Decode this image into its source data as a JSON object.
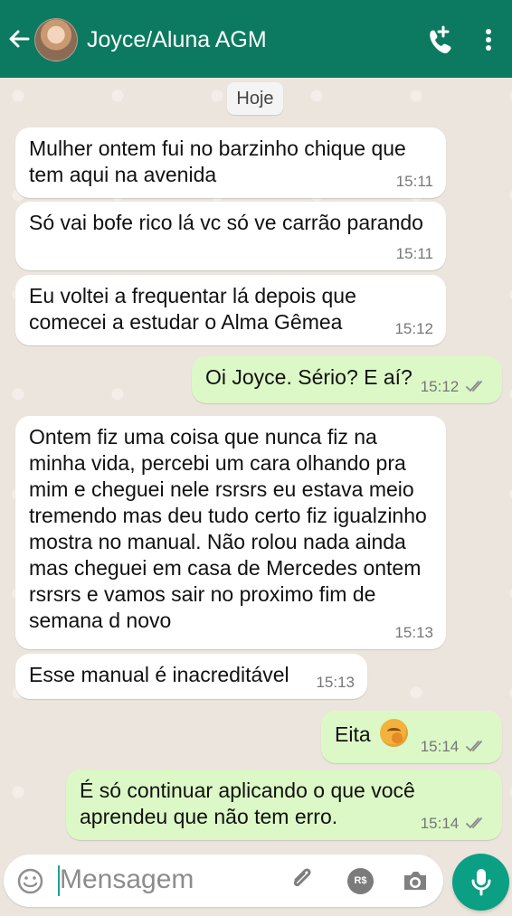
{
  "header": {
    "contact_name": "Joyce/Aluna AGM",
    "back_icon": "arrow-left-icon",
    "avatar": "contact-avatar",
    "call_add_icon": "add-call-icon",
    "menu_icon": "more-vert-icon",
    "colors": {
      "background": "#0b7a61",
      "text": "#ffffff"
    }
  },
  "chat": {
    "date_label": "Hoje",
    "messages": [
      {
        "direction": "in",
        "text": "Mulher ontem fui no barzinho chique que tem aqui na avenida",
        "time": "15:11"
      },
      {
        "direction": "in",
        "text": "Só vai bofe rico lá vc só ve carrão parando",
        "time": "15:11"
      },
      {
        "direction": "in",
        "text": "Eu voltei a frequentar lá depois que comecei a estudar o Alma Gêmea",
        "time": "15:12"
      },
      {
        "direction": "out",
        "text": "Oi Joyce. Sério? E aí?",
        "time": "15:12",
        "status": "read-double-check"
      },
      {
        "direction": "in",
        "text": "Ontem fiz uma coisa que nunca fiz na minha vida, percebi um cara olhando pra mim e cheguei nele rsrsrs eu estava meio tremendo mas deu tudo certo fiz igualzinho mostra no manual. Não rolou nada ainda mas cheguei em casa de Mercedes ontem rsrsrs e vamos sair no proximo fim de semana d novo",
        "time": "15:13"
      },
      {
        "direction": "in",
        "text": "Esse manual é inacreditável",
        "time": "15:13"
      },
      {
        "direction": "out",
        "text": "Eita",
        "time": "15:14",
        "status": "read-double-check",
        "emoji": "shushing-face-emoji"
      },
      {
        "direction": "out",
        "text": "É só continuar aplicando o que você aprendeu que não tem erro.",
        "time": "15:14",
        "status": "read-double-check"
      }
    ],
    "colors": {
      "incoming": "#ffffff",
      "outgoing": "#dcf8c6",
      "background": "#ece5dd"
    }
  },
  "composer": {
    "placeholder": "Mensagem",
    "emoji_icon": "emoji-icon",
    "attach_icon": "paperclip-icon",
    "payment_label": "R$",
    "camera_icon": "camera-icon",
    "mic_icon": "microphone-icon",
    "accent": "#0b9f84"
  }
}
